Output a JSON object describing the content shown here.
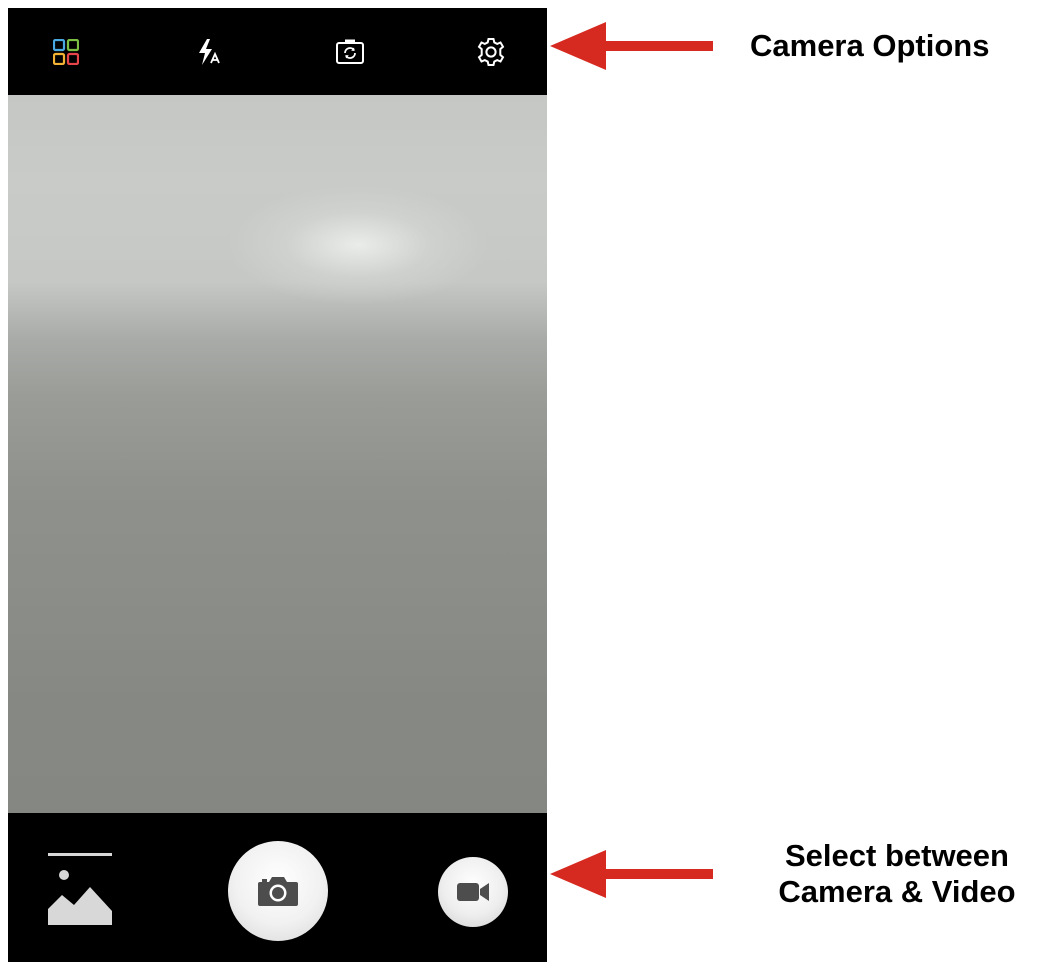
{
  "top_bar": {
    "icons": [
      "mode-grid-icon",
      "flash-auto-icon",
      "switch-camera-icon",
      "settings-gear-icon"
    ]
  },
  "bottom_bar": {
    "icons": [
      "gallery-icon",
      "camera-icon",
      "video-camera-icon"
    ]
  },
  "annotations": {
    "camera_options": "Camera Options",
    "select_line1": "Select between",
    "select_line2": "Camera & Video"
  },
  "colors": {
    "arrow": "#d62a20",
    "bar_background": "#000000",
    "mode_grid": [
      "#4aa8e0",
      "#7bc043",
      "#f2b234",
      "#e8454a"
    ]
  }
}
